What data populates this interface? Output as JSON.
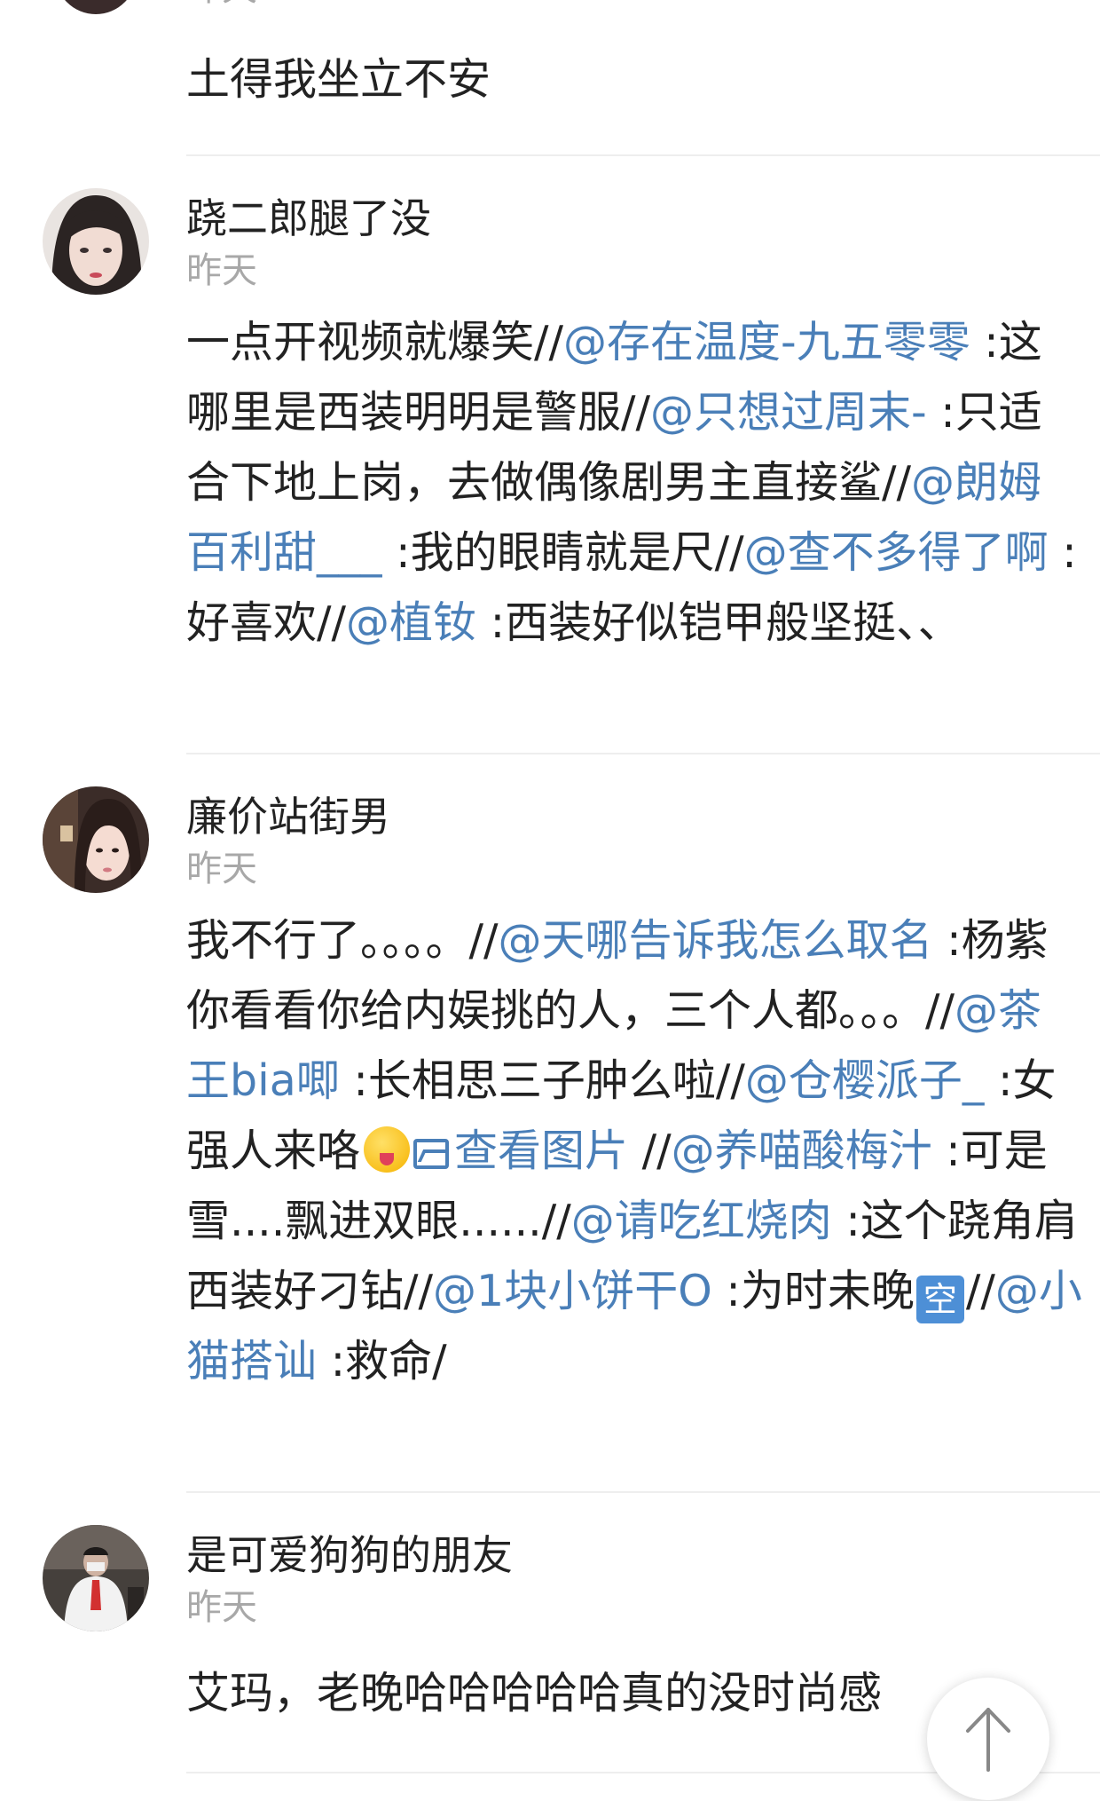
{
  "first_comment": {
    "time": "昨天",
    "body": "土得我坐立不安"
  },
  "comments": [
    {
      "username": "跷二郎腿了没",
      "time": "昨天",
      "segments": [
        {
          "t": "text",
          "v": "一点开视频就爆笑//"
        },
        {
          "t": "mention",
          "v": "@存在温度-九五零零"
        },
        {
          "t": "text",
          "v": " :这哪里是西装明明是警服//"
        },
        {
          "t": "mention",
          "v": "@只想过周末-"
        },
        {
          "t": "text",
          "v": " :只适合下地上岗，去做偶像剧男主直接鲨//"
        },
        {
          "t": "mention",
          "v": "@朗姆百利甜___"
        },
        {
          "t": "text",
          "v": " :我的眼睛就是尺//"
        },
        {
          "t": "mention",
          "v": "@查不多得了啊"
        },
        {
          "t": "text",
          "v": " :好喜欢//"
        },
        {
          "t": "mention",
          "v": "@植钕"
        },
        {
          "t": "text",
          "v": " :西装好似铠甲般坚挺、、"
        }
      ]
    },
    {
      "username": "廉价站街男",
      "time": "昨天",
      "segments": [
        {
          "t": "text",
          "v": "我不行了。。。。//"
        },
        {
          "t": "mention",
          "v": "@天哪告诉我怎么取名"
        },
        {
          "t": "text",
          "v": " :杨紫你看看你给内娱挑的人，三个人都。。。//"
        },
        {
          "t": "mention",
          "v": "@茶王bia唧"
        },
        {
          "t": "text",
          "v": " :长相思三子肿么啦//"
        },
        {
          "t": "mention",
          "v": "@仓樱派子_"
        },
        {
          "t": "text",
          "v": " :女强人来咯"
        },
        {
          "t": "emoji",
          "v": "tongue-face-emoji"
        },
        {
          "t": "imglink",
          "v": "查看图片"
        },
        {
          "t": "text",
          "v": " //"
        },
        {
          "t": "mention",
          "v": "@养喵酸梅汁"
        },
        {
          "t": "text",
          "v": " :可是雪....飘进双眼......//"
        },
        {
          "t": "mention",
          "v": "@请吃红烧肉"
        },
        {
          "t": "text",
          "v": " :这个跷角肩西装好刁钻//"
        },
        {
          "t": "mention",
          "v": "@1块小饼干O"
        },
        {
          "t": "text",
          "v": " :为时未晚"
        },
        {
          "t": "kong",
          "v": "空"
        },
        {
          "t": "text",
          "v": "//"
        },
        {
          "t": "mention",
          "v": "@小猫搭讪"
        },
        {
          "t": "text",
          "v": " :救命/"
        }
      ]
    },
    {
      "username": "是可爱狗狗的朋友",
      "time": "昨天",
      "segments": [
        {
          "t": "text",
          "v": "艾玛，老晚哈哈哈哈哈真的没时尚感"
        }
      ]
    }
  ],
  "colors": {
    "mention": "#4a7fb8",
    "time": "#a8a8a8",
    "text": "#222222"
  }
}
